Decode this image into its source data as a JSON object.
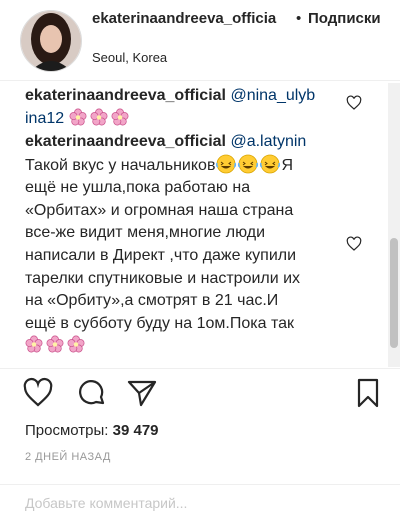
{
  "header": {
    "username": "ekaterinaandreeva_officia",
    "separator": "•",
    "follow_label": "Подписки",
    "location": "Seoul, Korea"
  },
  "comments": [
    {
      "username": "ekaterinaandreeva_official",
      "mention": "@nina_ulyb",
      "mention_tail": "ina12",
      "emoji": [
        "flower-emoji",
        "flower-emoji",
        "flower-emoji"
      ]
    },
    {
      "username": "ekaterinaandreeva_official",
      "mention": "@a.latynin",
      "line1": "Такой вкус у начальников",
      "line1_tail": "Я",
      "lines": [
        "ещё не ушла,пока работаю на",
        "«Орбитах» и огромная наша страна",
        "все-же видит меня,многие люди",
        "написали в Директ ,что даже купили",
        "тарелки спутниковые и настроили их",
        "на «Орбиту»,а смотрят в 21 час.И",
        "ещё в субботу буду на 1ом.Пока так"
      ],
      "emoji": [
        "flower-emoji",
        "flower-emoji",
        "flower-emoji"
      ]
    }
  ],
  "stats": {
    "views_label": "Просмотры:",
    "views_count": "39 479",
    "date": "2 ДНЕЙ НАЗАД"
  },
  "add_comment_placeholder": "Добавьте комментарий...",
  "icons": [
    "heart-icon",
    "comment-icon",
    "share-icon",
    "bookmark-icon"
  ],
  "colors": {
    "mention": "#003569",
    "flower": "#e86fa8"
  }
}
